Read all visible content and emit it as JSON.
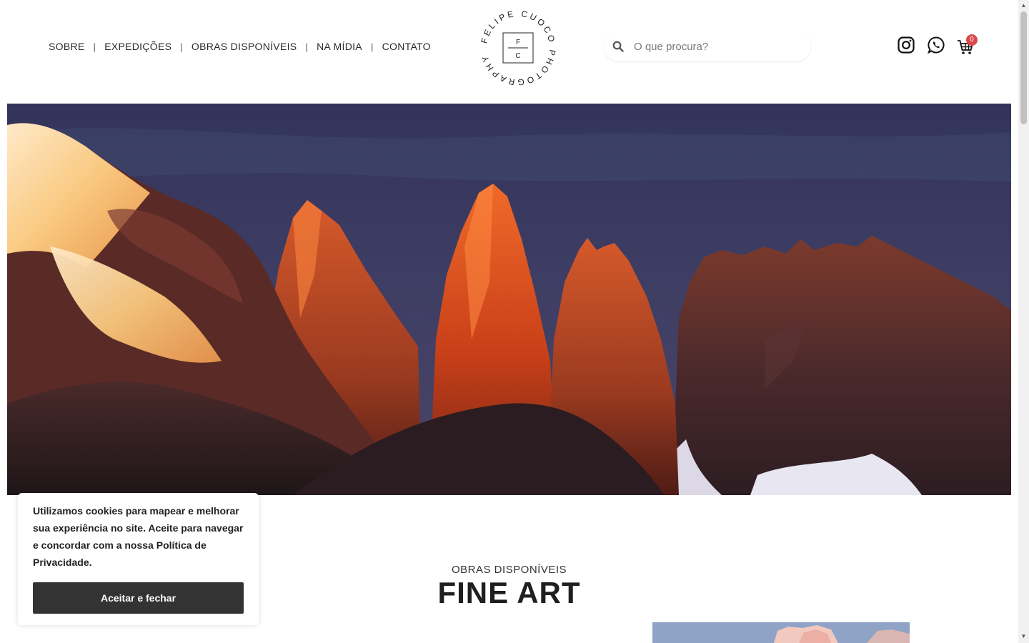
{
  "nav": {
    "items": [
      {
        "label": "SOBRE"
      },
      {
        "label": "EXPEDIÇÕES"
      },
      {
        "label": "OBRAS DISPONÍVEIS"
      },
      {
        "label": "NA MÍDIA"
      },
      {
        "label": "CONTATO"
      }
    ],
    "separator": "|"
  },
  "logo": {
    "ring_text": "FELIPE CUOCO PHOTOGRAPHY",
    "monogram_top": "F",
    "monogram_bottom": "C"
  },
  "search": {
    "placeholder": "O que procura?",
    "icon": "search-icon"
  },
  "header_icons": {
    "instagram": "instagram-icon",
    "whatsapp": "whatsapp-icon",
    "cart": "cart-icon",
    "cart_count": "0",
    "badge_color": "#d9474b"
  },
  "section": {
    "kicker": "OBRAS DISPONÍVEIS",
    "title": "FINE ART"
  },
  "cookie": {
    "message": "Utilizamos cookies para mapear e melhorar sua experiência no site. Aceite para navegar e concordar com a nossa Política de Privacidade.",
    "button_label": "Aceitar e fechar",
    "button_color": "#333333"
  },
  "scrollbar": {
    "up": "▲",
    "down": "▼"
  }
}
